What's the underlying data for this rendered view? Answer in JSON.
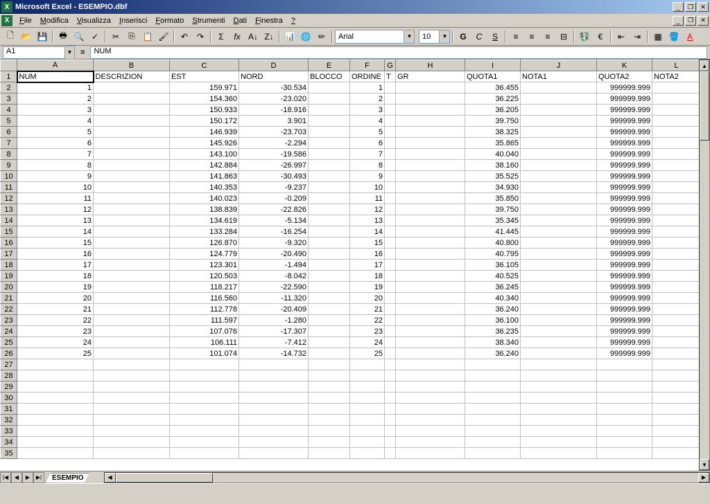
{
  "app": {
    "title": "Microsoft Excel - ESEMPIO.dbf"
  },
  "menubar": [
    "File",
    "Modifica",
    "Visualizza",
    "Inserisci",
    "Formato",
    "Strumenti",
    "Dati",
    "Finestra",
    "?"
  ],
  "formulabar": {
    "cell": "A1",
    "value": "NUM"
  },
  "toolbar": {
    "font": "Arial",
    "size": "10",
    "g": "G",
    "c": "C",
    "s": "S"
  },
  "columns": [
    "A",
    "B",
    "C",
    "D",
    "E",
    "F",
    "G",
    "H",
    "I",
    "J",
    "K",
    "L"
  ],
  "headers": {
    "A": "NUM",
    "B": "DESCRIZION",
    "C": "EST",
    "D": "NORD",
    "E": "BLOCCO",
    "F": "ORDINE",
    "G": "T",
    "H": "GR",
    "I": "QUOTA1",
    "J": "NOTA1",
    "K": "QUOTA2",
    "L": "NOTA2"
  },
  "rows": [
    {
      "n": "1",
      "est": "159.971",
      "nord": "-30.534",
      "ord": "1",
      "q1": "36.455",
      "q2": "999999.999"
    },
    {
      "n": "2",
      "est": "154.360",
      "nord": "-23.020",
      "ord": "2",
      "q1": "36.225",
      "q2": "999999.999"
    },
    {
      "n": "3",
      "est": "150.933",
      "nord": "-18.916",
      "ord": "3",
      "q1": "36.205",
      "q2": "999999.999"
    },
    {
      "n": "4",
      "est": "150.172",
      "nord": "3.901",
      "ord": "4",
      "q1": "39.750",
      "q2": "999999.999"
    },
    {
      "n": "5",
      "est": "146.939",
      "nord": "-23.703",
      "ord": "5",
      "q1": "38.325",
      "q2": "999999.999"
    },
    {
      "n": "6",
      "est": "145.926",
      "nord": "-2.294",
      "ord": "6",
      "q1": "35.865",
      "q2": "999999.999"
    },
    {
      "n": "7",
      "est": "143.100",
      "nord": "-19.586",
      "ord": "7",
      "q1": "40.040",
      "q2": "999999.999"
    },
    {
      "n": "8",
      "est": "142.884",
      "nord": "-26.997",
      "ord": "8",
      "q1": "38.160",
      "q2": "999999.999"
    },
    {
      "n": "9",
      "est": "141.863",
      "nord": "-30.493",
      "ord": "9",
      "q1": "35.525",
      "q2": "999999.999"
    },
    {
      "n": "10",
      "est": "140.353",
      "nord": "-9.237",
      "ord": "10",
      "q1": "34.930",
      "q2": "999999.999"
    },
    {
      "n": "11",
      "est": "140.023",
      "nord": "-0.209",
      "ord": "11",
      "q1": "35.850",
      "q2": "999999.999"
    },
    {
      "n": "12",
      "est": "138.839",
      "nord": "-22.826",
      "ord": "12",
      "q1": "39.750",
      "q2": "999999.999"
    },
    {
      "n": "13",
      "est": "134.619",
      "nord": "-5.134",
      "ord": "13",
      "q1": "35.345",
      "q2": "999999.999"
    },
    {
      "n": "14",
      "est": "133.284",
      "nord": "-16.254",
      "ord": "14",
      "q1": "41.445",
      "q2": "999999.999"
    },
    {
      "n": "15",
      "est": "126.870",
      "nord": "-9.320",
      "ord": "15",
      "q1": "40.800",
      "q2": "999999.999"
    },
    {
      "n": "16",
      "est": "124.779",
      "nord": "-20.490",
      "ord": "16",
      "q1": "40.795",
      "q2": "999999.999"
    },
    {
      "n": "17",
      "est": "123.301",
      "nord": "-1.494",
      "ord": "17",
      "q1": "36.105",
      "q2": "999999.999"
    },
    {
      "n": "18",
      "est": "120.503",
      "nord": "-8.042",
      "ord": "18",
      "q1": "40.525",
      "q2": "999999.999"
    },
    {
      "n": "19",
      "est": "118.217",
      "nord": "-22.590",
      "ord": "19",
      "q1": "36.245",
      "q2": "999999.999"
    },
    {
      "n": "20",
      "est": "116.560",
      "nord": "-11.320",
      "ord": "20",
      "q1": "40.340",
      "q2": "999999.999"
    },
    {
      "n": "21",
      "est": "112.778",
      "nord": "-20.409",
      "ord": "21",
      "q1": "36.240",
      "q2": "999999.999"
    },
    {
      "n": "22",
      "est": "111.597",
      "nord": "-1.280",
      "ord": "22",
      "q1": "36.100",
      "q2": "999999.999"
    },
    {
      "n": "23",
      "est": "107.076",
      "nord": "-17.307",
      "ord": "23",
      "q1": "36.235",
      "q2": "999999.999"
    },
    {
      "n": "24",
      "est": "106.111",
      "nord": "-7.412",
      "ord": "24",
      "q1": "38.340",
      "q2": "999999.999"
    },
    {
      "n": "25",
      "est": "101.074",
      "nord": "-14.732",
      "ord": "25",
      "q1": "36.240",
      "q2": "999999.999"
    }
  ],
  "emptyRows": [
    27,
    28,
    29,
    30,
    31,
    32,
    33,
    34,
    35
  ],
  "sheet": {
    "name": "ESEMPIO"
  },
  "status": {
    "text": ""
  }
}
